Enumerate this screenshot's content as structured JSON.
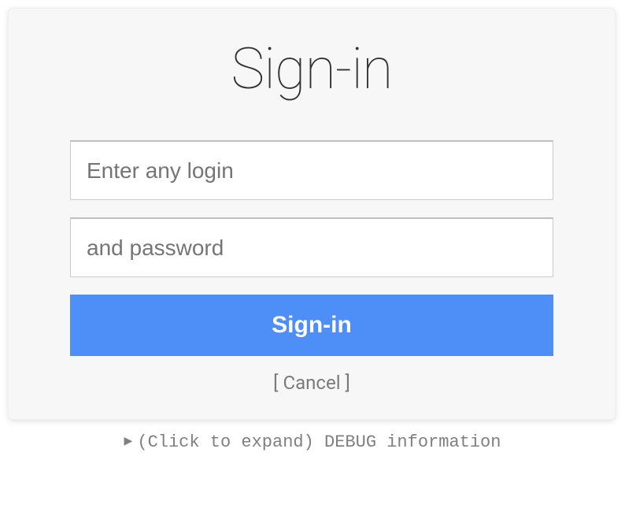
{
  "title": "Sign-in",
  "form": {
    "login_placeholder": "Enter any login",
    "password_placeholder": "and password",
    "submit_label": "Sign-in",
    "cancel_label": "[ Cancel ]"
  },
  "debug": {
    "arrow": "▶",
    "text": "(Click to expand) DEBUG information"
  }
}
